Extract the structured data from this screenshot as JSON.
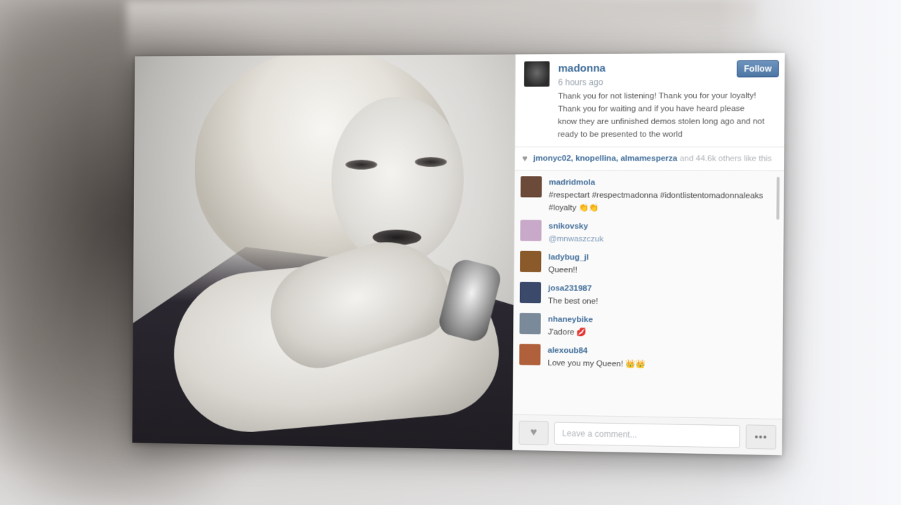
{
  "post": {
    "username": "madonna",
    "time": "6 hours ago",
    "follow_label": "Follow",
    "caption": "Thank you for not listening! Thank you for your loyalty! Thank you for waiting and if you have heard please know they are unfinished demos stolen long ago and not ready to be presented to the world"
  },
  "likes": {
    "names": "jmonyc02, knopellina, almamesperza",
    "rest": " and 44.6k others like this",
    "icon": "heart-icon"
  },
  "comments": [
    {
      "user": "madridmola",
      "text": "#respectart #respectmadonna #idontlistentomadonnaleaks #loyalty 👏👏",
      "avatar_color": "#6b4a3a",
      "link": false
    },
    {
      "user": "snikovsky",
      "text": "@mnwaszczuk",
      "avatar_color": "#c9a9c9",
      "link": true
    },
    {
      "user": "ladybug_jl",
      "text": "Queen!!",
      "avatar_color": "#8a5a2a",
      "link": false
    },
    {
      "user": "josa231987",
      "text": "The best one!",
      "avatar_color": "#3b4a6b",
      "link": false
    },
    {
      "user": "nhaneybike",
      "text": "J'adore 💋",
      "avatar_color": "#7a8a9a",
      "link": false
    },
    {
      "user": "alexoub84",
      "text": "Love you my Queen! 👑👑",
      "avatar_color": "#b0603a",
      "link": false
    }
  ],
  "footer": {
    "comment_placeholder": "Leave a comment...",
    "more_label": "•••",
    "like_icon": "heart-icon"
  }
}
